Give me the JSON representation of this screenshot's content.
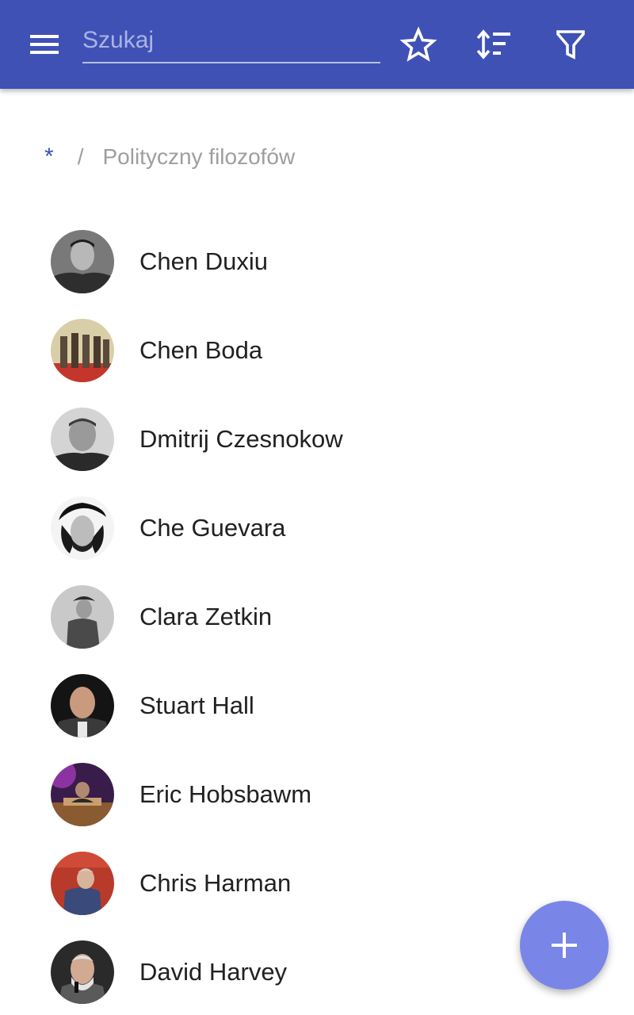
{
  "colors": {
    "app_bar": "#3f51b5",
    "fab": "#7986e8",
    "breadcrumb_root": "#3f51b5",
    "breadcrumb_muted": "#9e9e9e",
    "text_primary": "#212121"
  },
  "header": {
    "menu_icon": "hamburger-menu-icon",
    "search": {
      "placeholder": "Szukaj",
      "value": ""
    },
    "actions": [
      {
        "icon": "star-outline-icon"
      },
      {
        "icon": "sort-icon"
      },
      {
        "icon": "filter-icon"
      }
    ]
  },
  "breadcrumb": {
    "root": "*",
    "separator": "/",
    "current": "Polityczny filozofów"
  },
  "list": {
    "items": [
      {
        "name": "Chen Duxiu",
        "avatar": "portrait-photo"
      },
      {
        "name": "Chen Boda",
        "avatar": "portrait-photo"
      },
      {
        "name": "Dmitrij Czesnokow",
        "avatar": "portrait-photo"
      },
      {
        "name": "Che Guevara",
        "avatar": "portrait-photo"
      },
      {
        "name": "Clara Zetkin",
        "avatar": "portrait-photo"
      },
      {
        "name": "Stuart Hall",
        "avatar": "portrait-photo"
      },
      {
        "name": "Eric Hobsbawm",
        "avatar": "portrait-photo"
      },
      {
        "name": "Chris Harman",
        "avatar": "portrait-photo"
      },
      {
        "name": "David Harvey",
        "avatar": "portrait-photo"
      }
    ]
  },
  "fab": {
    "icon": "plus-icon"
  }
}
